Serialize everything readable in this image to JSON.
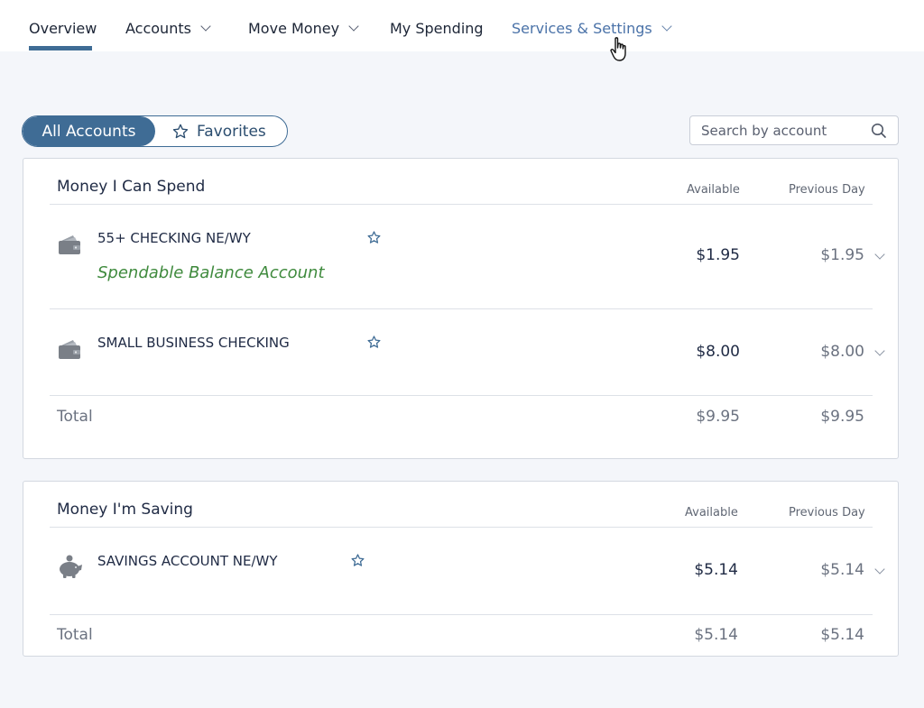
{
  "nav": {
    "items": [
      {
        "label": "Overview"
      },
      {
        "label": "Accounts"
      },
      {
        "label": "Move Money"
      },
      {
        "label": "My Spending"
      },
      {
        "label": "Services & Settings"
      }
    ],
    "active": "Overview"
  },
  "toggle": {
    "all_label": "All Accounts",
    "favorites_label": "Favorites"
  },
  "search": {
    "placeholder": "Search by account"
  },
  "spend": {
    "title": "Money I Can Spend",
    "col_available": "Available",
    "col_previous": "Previous Day",
    "accounts": [
      {
        "name": "55+ CHECKING NE/WY",
        "subtitle": "Spendable Balance Account",
        "available": "$1.95",
        "previous": "$1.95",
        "icon": "wallet-icon"
      },
      {
        "name": "SMALL BUSINESS CHECKING",
        "available": "$8.00",
        "previous": "$8.00",
        "icon": "wallet-icon"
      }
    ],
    "total_label": "Total",
    "total_available": "$9.95",
    "total_previous": "$9.95"
  },
  "saving": {
    "title": "Money I'm Saving",
    "col_available": "Available",
    "col_previous": "Previous Day",
    "accounts": [
      {
        "name": "SAVINGS ACCOUNT NE/WY",
        "available": "$5.14",
        "previous": "$5.14",
        "icon": "piggy-bank-icon"
      }
    ],
    "total_label": "Total",
    "total_available": "$5.14",
    "total_previous": "$5.14"
  },
  "colors": {
    "accent": "#3f6c95",
    "subtitle_green": "#3f8a3d",
    "page_bg": "#f4f6fa"
  }
}
